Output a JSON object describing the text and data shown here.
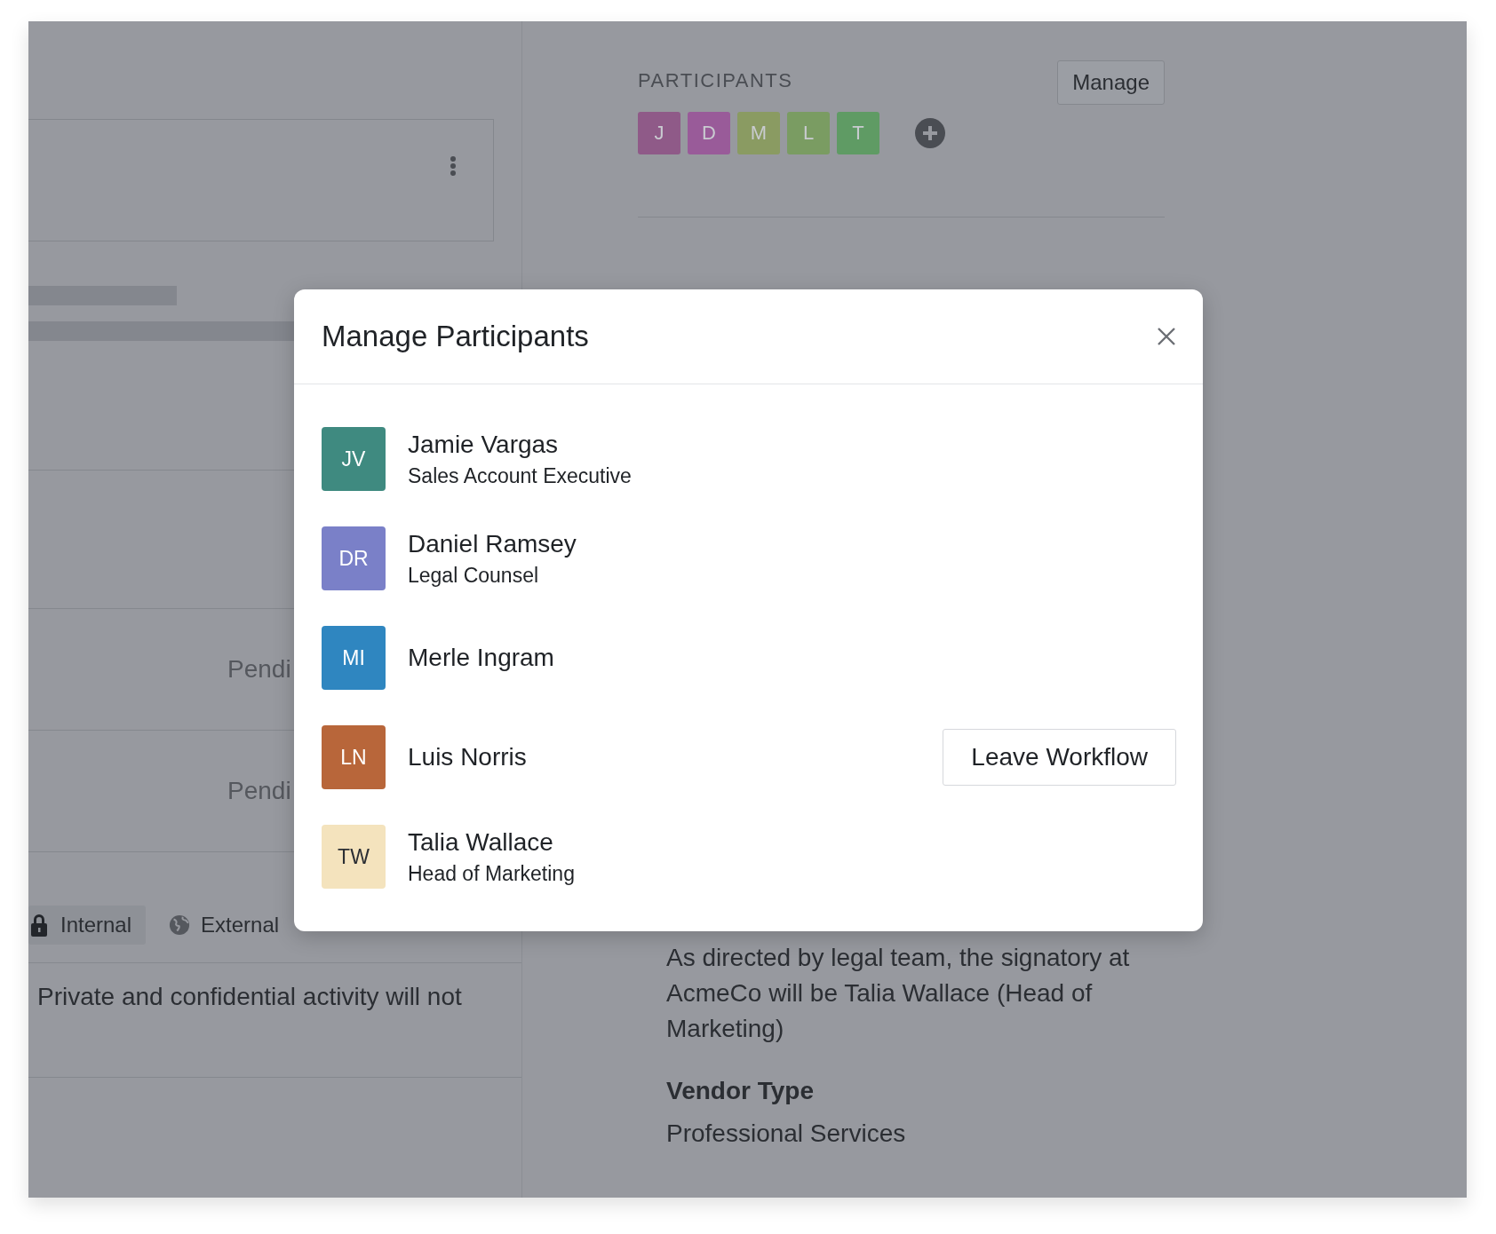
{
  "left_panel": {
    "status_rows": [
      "Pendi",
      "Pendi"
    ],
    "tabs": [
      {
        "label": "Internal",
        "kind": "lock",
        "selected": true
      },
      {
        "label": "External",
        "kind": "globe",
        "selected": false
      }
    ],
    "message_notice": "Private and confidential activity will not"
  },
  "right_panel": {
    "participants_heading": "PARTICIPANTS",
    "manage_button": "Manage",
    "participant_chips": [
      {
        "initial": "J",
        "color": "#8f5a88"
      },
      {
        "initial": "D",
        "color": "#995b99"
      },
      {
        "initial": "M",
        "color": "#8a9b62"
      },
      {
        "initial": "L",
        "color": "#7a9c62"
      },
      {
        "initial": "T",
        "color": "#5f9b64"
      }
    ],
    "description": "As directed by legal team, the signatory at AcmeCo will be Talia Wallace (Head of Marketing)",
    "fields": [
      {
        "label": "Vendor Type",
        "value": "Professional Services"
      }
    ]
  },
  "modal": {
    "title": "Manage Participants",
    "participants": [
      {
        "initials": "JV",
        "name": "Jamie Vargas",
        "role": "Sales Account Executive",
        "color": "#3f8a80"
      },
      {
        "initials": "DR",
        "name": "Daniel Ramsey",
        "role": "Legal Counsel",
        "color": "#7a80c8"
      },
      {
        "initials": "MI",
        "name": "Merle Ingram",
        "color": "#2f86c0"
      },
      {
        "initials": "LN",
        "name": "Luis Norris",
        "color": "#b8663a",
        "action": "Leave Workflow"
      },
      {
        "initials": "TW",
        "name": "Talia Wallace",
        "role": "Head of Marketing",
        "color": "#f4e3bd"
      }
    ]
  }
}
